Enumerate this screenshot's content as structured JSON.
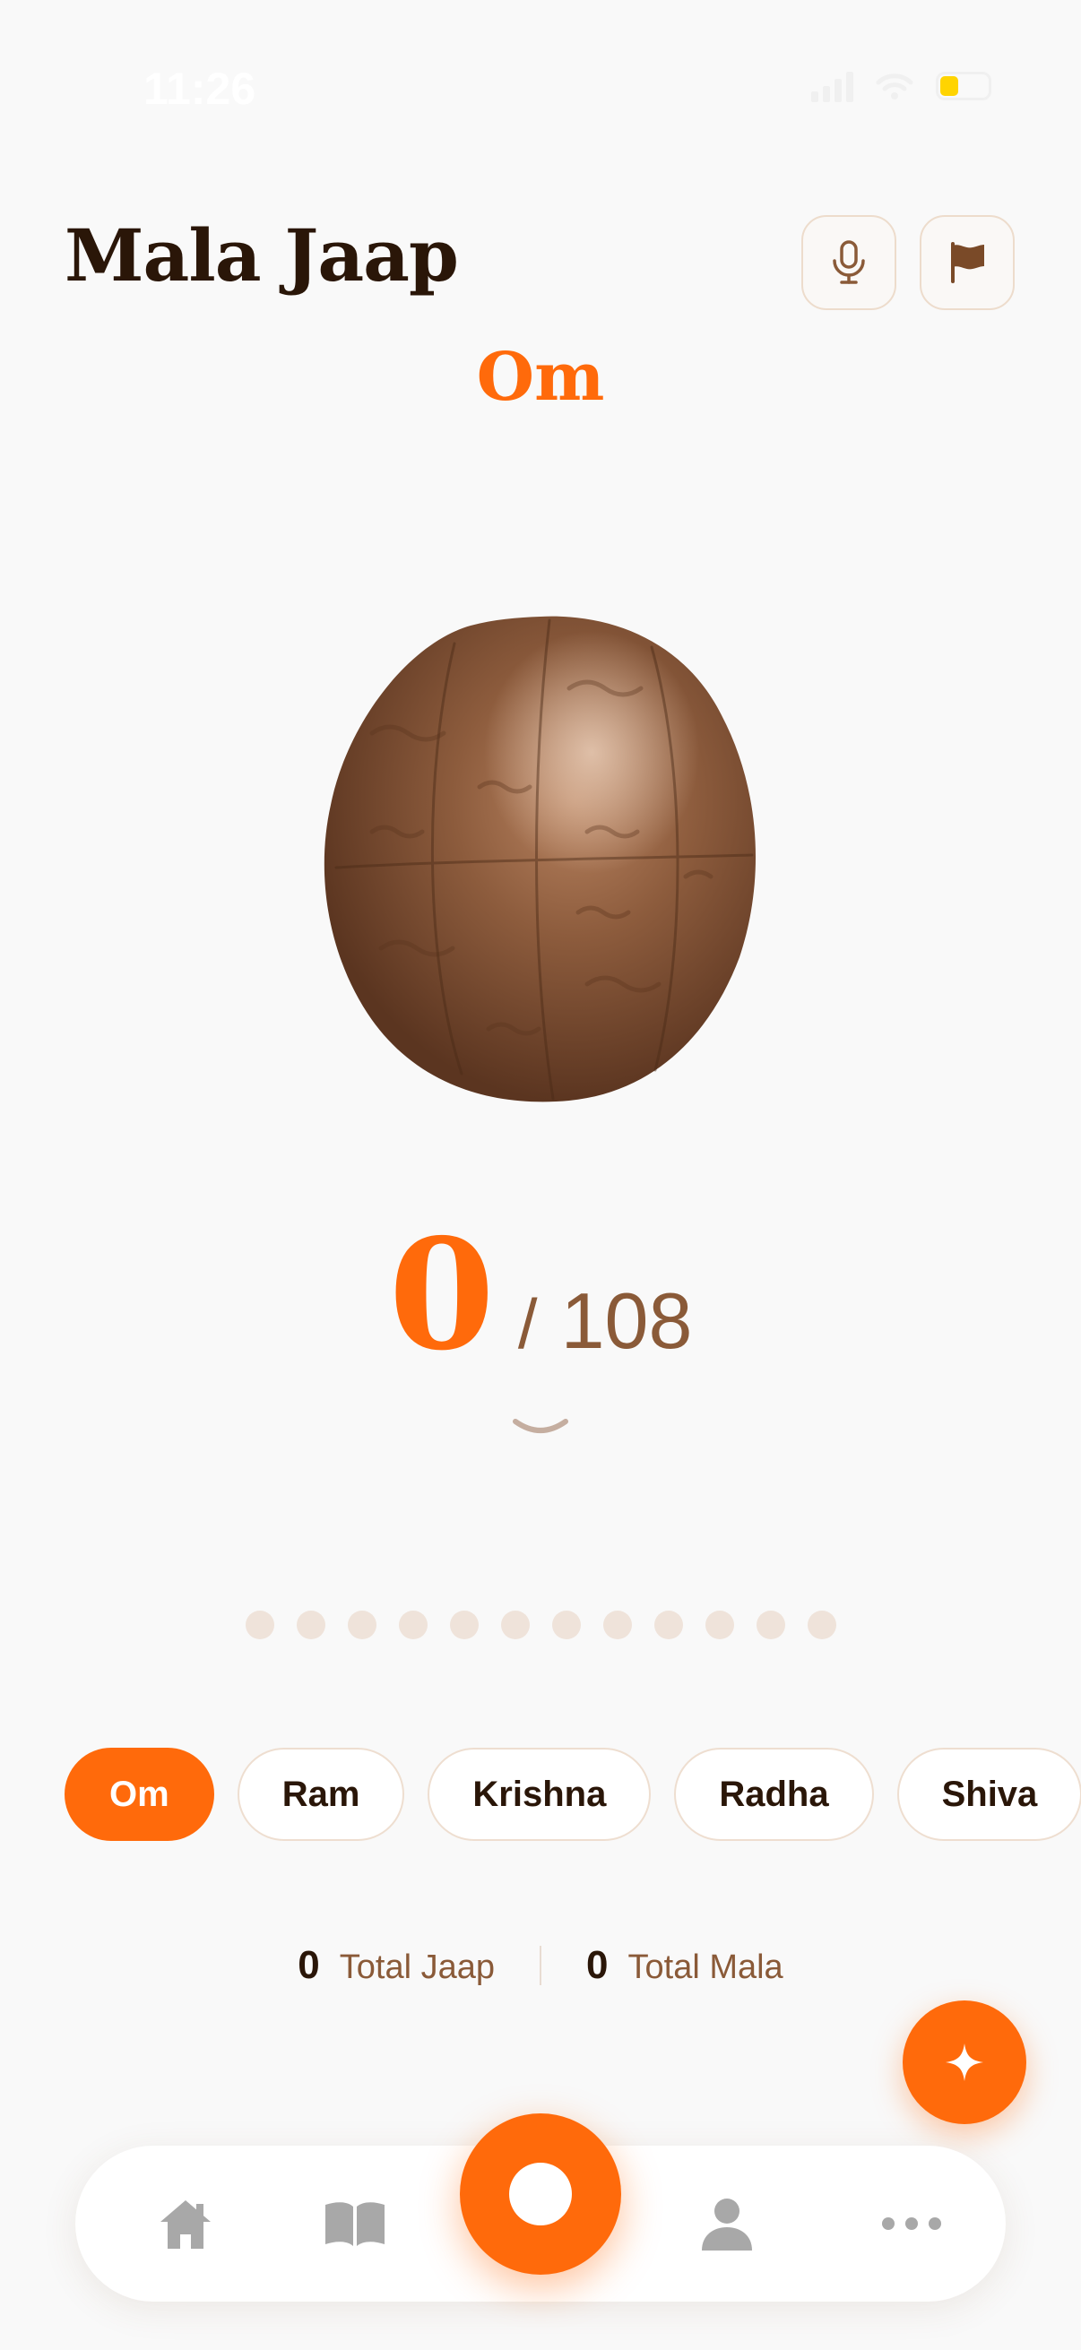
{
  "status": {
    "time": "11:26"
  },
  "header": {
    "title": "Mala Jaap"
  },
  "mantra": {
    "current": "Om"
  },
  "counter": {
    "current": "0",
    "separator": "/",
    "total": "108"
  },
  "progress_dots": {
    "count": 12
  },
  "chips": [
    {
      "label": "Om",
      "active": true
    },
    {
      "label": "Ram",
      "active": false
    },
    {
      "label": "Krishna",
      "active": false
    },
    {
      "label": "Radha",
      "active": false
    },
    {
      "label": "Shiva",
      "active": false
    }
  ],
  "stats": {
    "total_jaap": {
      "value": "0",
      "label": "Total Jaap"
    },
    "total_mala": {
      "value": "0",
      "label": "Total Mala"
    }
  },
  "icons": {
    "header": [
      "microphone-icon",
      "flag-icon"
    ],
    "fab": "sparkle-icon",
    "tabs": [
      "home-icon",
      "book-icon",
      "mala-counter-icon",
      "profile-icon",
      "more-icon"
    ]
  },
  "colors": {
    "accent": "#ff6a0b",
    "title": "#2a1608",
    "muted": "#8a5a38",
    "background": "#f9f9f9"
  }
}
